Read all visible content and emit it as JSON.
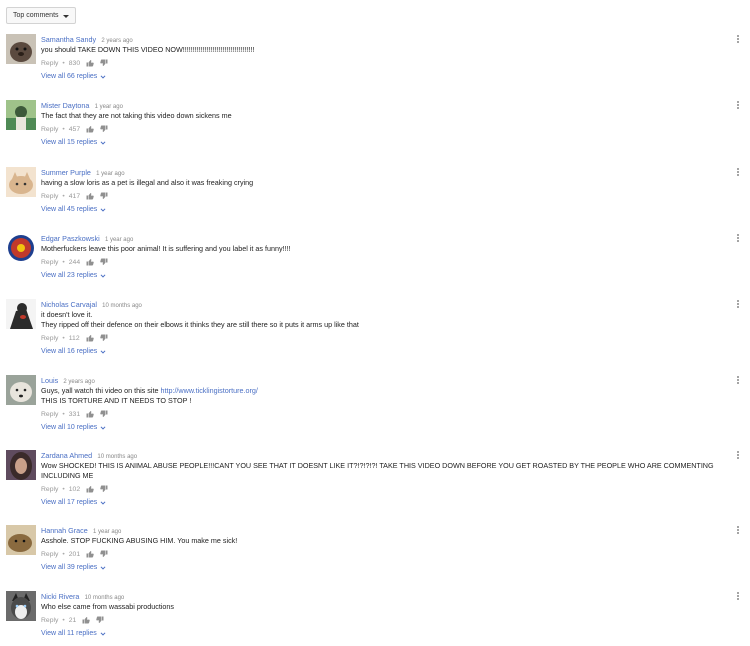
{
  "sort": {
    "label": "Top comments"
  },
  "comments": [
    {
      "author": "Samantha Sandy",
      "time": "2 years ago",
      "lines": [
        "you should TAKE DOWN THIS VIDEO NOW!!!!!!!!!!!!!!!!!!!!!!!!!!!!!!!!!!!!"
      ],
      "link": "",
      "reply": "Reply",
      "likes": "830",
      "view_replies": "View all 66 replies",
      "avatar": "bear-photo",
      "avatar_color": "#5b4a3f"
    },
    {
      "author": "Mister Daytona",
      "time": "1 year ago",
      "lines": [
        "The fact that they are not taking this video down sickens me"
      ],
      "link": "",
      "reply": "Reply",
      "likes": "457",
      "view_replies": "View all 15 replies",
      "avatar": "person-green-photo",
      "avatar_color": "#4f8a55"
    },
    {
      "author": "Summer Purple",
      "time": "1 year ago",
      "lines": [
        "having a slow loris as a pet is illegal and also it was freaking crying"
      ],
      "link": "",
      "reply": "Reply",
      "likes": "417",
      "view_replies": "View all 45 replies",
      "avatar": "cat-photo",
      "avatar_color": "#d9b58e"
    },
    {
      "author": "Edgar Paszkowski",
      "time": "1 year ago",
      "lines": [
        "Motherfuckers leave this poor animal! It is suffering and you label it as funny!!!!"
      ],
      "link": "",
      "reply": "Reply",
      "likes": "244",
      "view_replies": "View all 23 replies",
      "avatar": "red-badge-logo",
      "avatar_color": "#c0392b"
    },
    {
      "author": "Nicholas Carvajal",
      "time": "10 months ago",
      "lines": [
        "it doesn't love it.",
        "They ripped off their defence on their elbows it thinks they are still there so it puts it arms up like that"
      ],
      "link": "",
      "reply": "Reply",
      "likes": "112",
      "view_replies": "View all 16 replies",
      "avatar": "dark-figure-photo",
      "avatar_color": "#2b2b2b"
    },
    {
      "author": "Louis",
      "time": "2 years ago",
      "lines": [
        "Guys, yall watch thi video on this site ",
        "THIS IS TORTURE AND IT NEEDS TO STOP !"
      ],
      "link": "http://www.ticklingistorture.org/",
      "reply": "Reply",
      "likes": "331",
      "view_replies": "View all 10 replies",
      "avatar": "white-dog-photo",
      "avatar_color": "#e8e4dc"
    },
    {
      "author": "Zardana Ahmed",
      "time": "10 months ago",
      "lines": [
        "Wow SHOCKED! THIS IS ANIMAL ABUSE PEOPLE!!!CANT YOU SEE THAT IT DOESNT LIKE IT?!?!?!?! TAKE THIS VIDEO DOWN BEFORE YOU GET ROASTED BY THE PEOPLE WHO ARE COMMENTING",
        "INCLUDING ME"
      ],
      "link": "",
      "reply": "Reply",
      "likes": "102",
      "view_replies": "View all 17 replies",
      "avatar": "woman-dark-hair-photo",
      "avatar_color": "#3a2a2a"
    },
    {
      "author": "Hannah Grace",
      "time": "1 year ago",
      "lines": [
        "Asshole. STOP FUCKING ABUSING HIM. You make me sick!"
      ],
      "link": "",
      "reply": "Reply",
      "likes": "201",
      "view_replies": "View all 39 replies",
      "avatar": "animal-brown-photo",
      "avatar_color": "#8a6a3f"
    },
    {
      "author": "Nicki Rivera",
      "time": "10 months ago",
      "lines": [
        "Who else came from wassabi productions"
      ],
      "link": "",
      "reply": "Reply",
      "likes": "21",
      "view_replies": "View all 11 replies",
      "avatar": "husky-dog-photo",
      "avatar_color": "#4a4a4a"
    }
  ],
  "icons": {
    "like": "thumbs-up-icon",
    "dislike": "thumbs-down-icon",
    "expand": "chevron-down-icon",
    "menu": "more-vertical-icon",
    "sort": "caret-down-icon"
  },
  "colors": {
    "link": "#4a6fc4",
    "muted": "#999999"
  }
}
